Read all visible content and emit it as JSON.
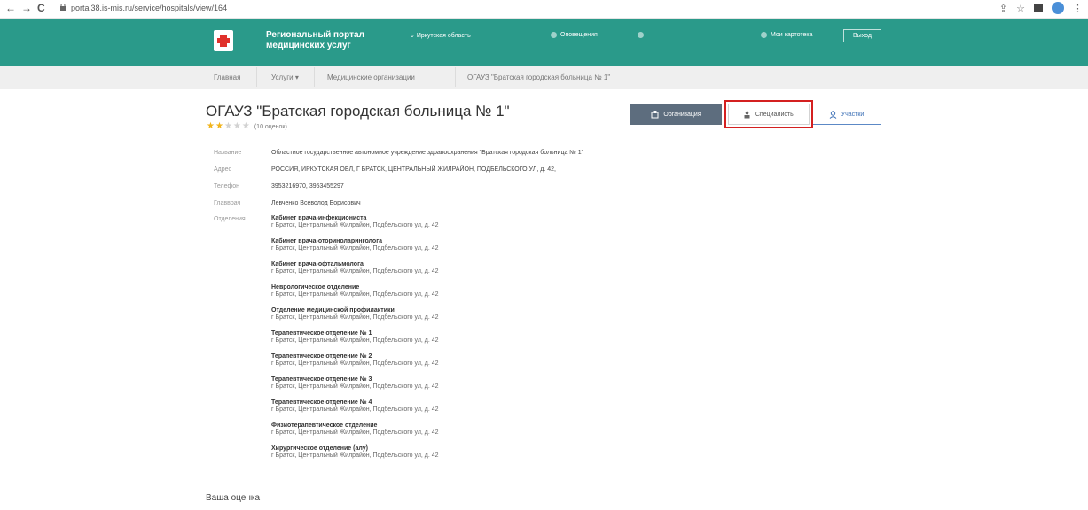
{
  "browser": {
    "url": "portal38.is-mis.ru/service/hospitals/view/164"
  },
  "header": {
    "portal_title": "Региональный портал медицинских услуг",
    "region": "Иркутская область",
    "notifications": "Оповещения",
    "cards": "Мои картотека",
    "logout": "Выход",
    "brand_color": "#2a9a8a"
  },
  "breadcrumbs": [
    "Главная",
    "Услуги",
    "Медицинские организации",
    "ОГАУЗ \"Братская городская больница № 1\""
  ],
  "org": {
    "title": "ОГАУЗ \"Братская городская больница № 1\"",
    "rating": 2,
    "rating_max": 5,
    "reviews": "(10 оценок)"
  },
  "buttons": {
    "organization": "Организация",
    "specialists": "Специалисты",
    "areas": "Участки"
  },
  "fields": {
    "name_label": "Название",
    "name_value": "Областное государственное автономное учреждение здравоохранения \"Братская городская больница № 1\"",
    "address_label": "Адрес",
    "address_value": "РОССИЯ, ИРКУТСКАЯ ОБЛ, Г БРАТСК, ЦЕНТРАЛЬНЫЙ ЖИЛРАЙОН, ПОДБЕЛЬСКОГО УЛ, д. 42,",
    "phone_label": "Телефон",
    "phone_value": "3953216970, 3953455297",
    "chief_label": "Главврач",
    "chief_value": "Левченко Всеволод Борисович",
    "departments_label": "Отделения"
  },
  "departments": [
    {
      "name": "Кабинет врача-инфекциониста",
      "address": "г Братск, Центральный Жилрайон, Подбельского ул, д. 42"
    },
    {
      "name": "Кабинет врача-оториноларинголога",
      "address": "г Братск, Центральный Жилрайон, Подбельского ул, д. 42"
    },
    {
      "name": "Кабинет врача-офтальмолога",
      "address": "г Братск, Центральный Жилрайон, Подбельского ул, д. 42"
    },
    {
      "name": "Неврологическое отделение",
      "address": "г Братск, Центральный Жилрайон, Подбельского ул, д. 42"
    },
    {
      "name": "Отделение медицинской профилактики",
      "address": "г Братск, Центральный Жилрайон, Подбельского ул, д. 42"
    },
    {
      "name": "Терапевтическое отделение № 1",
      "address": "г Братск, Центральный Жилрайон, Подбельского ул, д. 42"
    },
    {
      "name": "Терапевтическое отделение № 2",
      "address": "г Братск, Центральный Жилрайон, Подбельского ул, д. 42"
    },
    {
      "name": "Терапевтическое отделение № 3",
      "address": "г Братск, Центральный Жилрайон, Подбельского ул, д. 42"
    },
    {
      "name": "Терапевтическое отделение № 4",
      "address": "г Братск, Центральный Жилрайон, Подбельского ул, д. 42"
    },
    {
      "name": "Физиотерапевтическое отделение",
      "address": "г Братск, Центральный Жилрайон, Подбельского ул, д. 42"
    },
    {
      "name": "Хирургическое отделение (алу)",
      "address": "г Братск, Центральный Жилрайон, Подбельского ул, д. 42"
    }
  ],
  "rating_section": {
    "title": "Ваша оценка"
  },
  "icons": [
    "back-icon",
    "forward-icon",
    "reload-icon",
    "lock-icon",
    "share-icon",
    "bookmark-star-icon",
    "extension-icon",
    "profile-icon",
    "menu-dots-icon",
    "logo-cross-icon",
    "chevron-down-icon",
    "building-icon",
    "people-icon",
    "person-pin-icon"
  ]
}
